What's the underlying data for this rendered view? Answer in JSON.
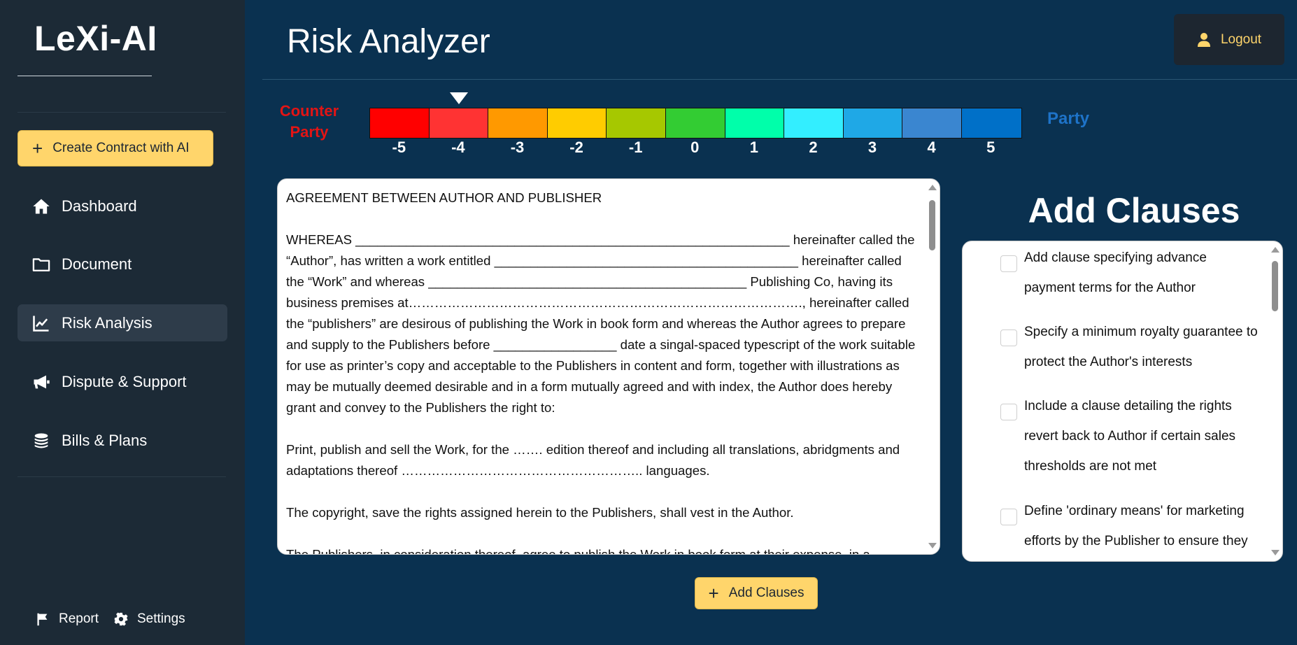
{
  "app": {
    "name": "LeXi-AI"
  },
  "sidebar": {
    "create_button": "Create Contract with AI",
    "items": [
      {
        "label": "Dashboard",
        "icon": "home-icon"
      },
      {
        "label": "Document",
        "icon": "folder-icon"
      },
      {
        "label": "Risk Analysis",
        "icon": "chart-line-icon",
        "active": true
      },
      {
        "label": "Dispute & Support",
        "icon": "megaphone-icon"
      },
      {
        "label": "Bills & Plans",
        "icon": "coins-icon"
      }
    ],
    "footer": {
      "report": "Report",
      "settings": "Settings"
    }
  },
  "header": {
    "title": "Risk Analyzer",
    "logout": "Logout"
  },
  "risk_scale": {
    "left_label_line1": "Counter",
    "left_label_line2": "Party",
    "right_label": "Party",
    "labels": [
      "-5",
      "-4",
      "-3",
      "-2",
      "-1",
      "0",
      "1",
      "2",
      "3",
      "4",
      "5"
    ],
    "colors": [
      "#ff0000",
      "#ff3333",
      "#ff9900",
      "#ffcc00",
      "#a6c800",
      "#33cc33",
      "#00ffaa",
      "#33eeff",
      "#1fa8e6",
      "#3a86d0",
      "#0070c8"
    ],
    "selected_value": -4
  },
  "document": {
    "text": "AGREEMENT BETWEEN AUTHOR AND PUBLISHER\n\nWHEREAS ____________________________________________________________ hereinafter called the “Author”, has written a work entitled __________________________________________ hereinafter called the “Work” and whereas ____________________________________________ Publishing Co, having its business premises at………………………………………………………………………………., hereinafter called the “publishers” are desirous of publishing the Work in book form and whereas the Author agrees to prepare and supply to the Publishers before _________________ date a singal-spaced typescript of the work suitable for use as printer’s copy and acceptable to the Publishers in content and form, together with illustrations as may be mutually deemed desirable and in a form mutually agreed and with index, the Author does hereby grant and convey to the Publishers the right to:\n\nPrint, publish and sell the Work, for the ……. edition thereof and including all translations, abridgments and adaptations thereof ……………………………………………….. languages.\n\nThe copyright, save the rights assigned herein to the Publishers, shall vest in the Author.\n\nThe Publishers, in consideration thereof, agree to publish the Work in book form at their expense, in a"
  },
  "clauses": {
    "title": "Add Clauses",
    "items": [
      {
        "label": "Add clause specifying advance payment terms for the Author",
        "checked": false
      },
      {
        "label": "Specify a minimum royalty guarantee to protect the Author's interests",
        "checked": false
      },
      {
        "label": "Include a clause detailing the rights revert back to Author if certain sales thresholds are not met",
        "checked": false
      },
      {
        "label": "Define 'ordinary means' for marketing efforts by the Publisher to ensure they",
        "checked": false
      }
    ],
    "add_button": "Add Clauses"
  }
}
